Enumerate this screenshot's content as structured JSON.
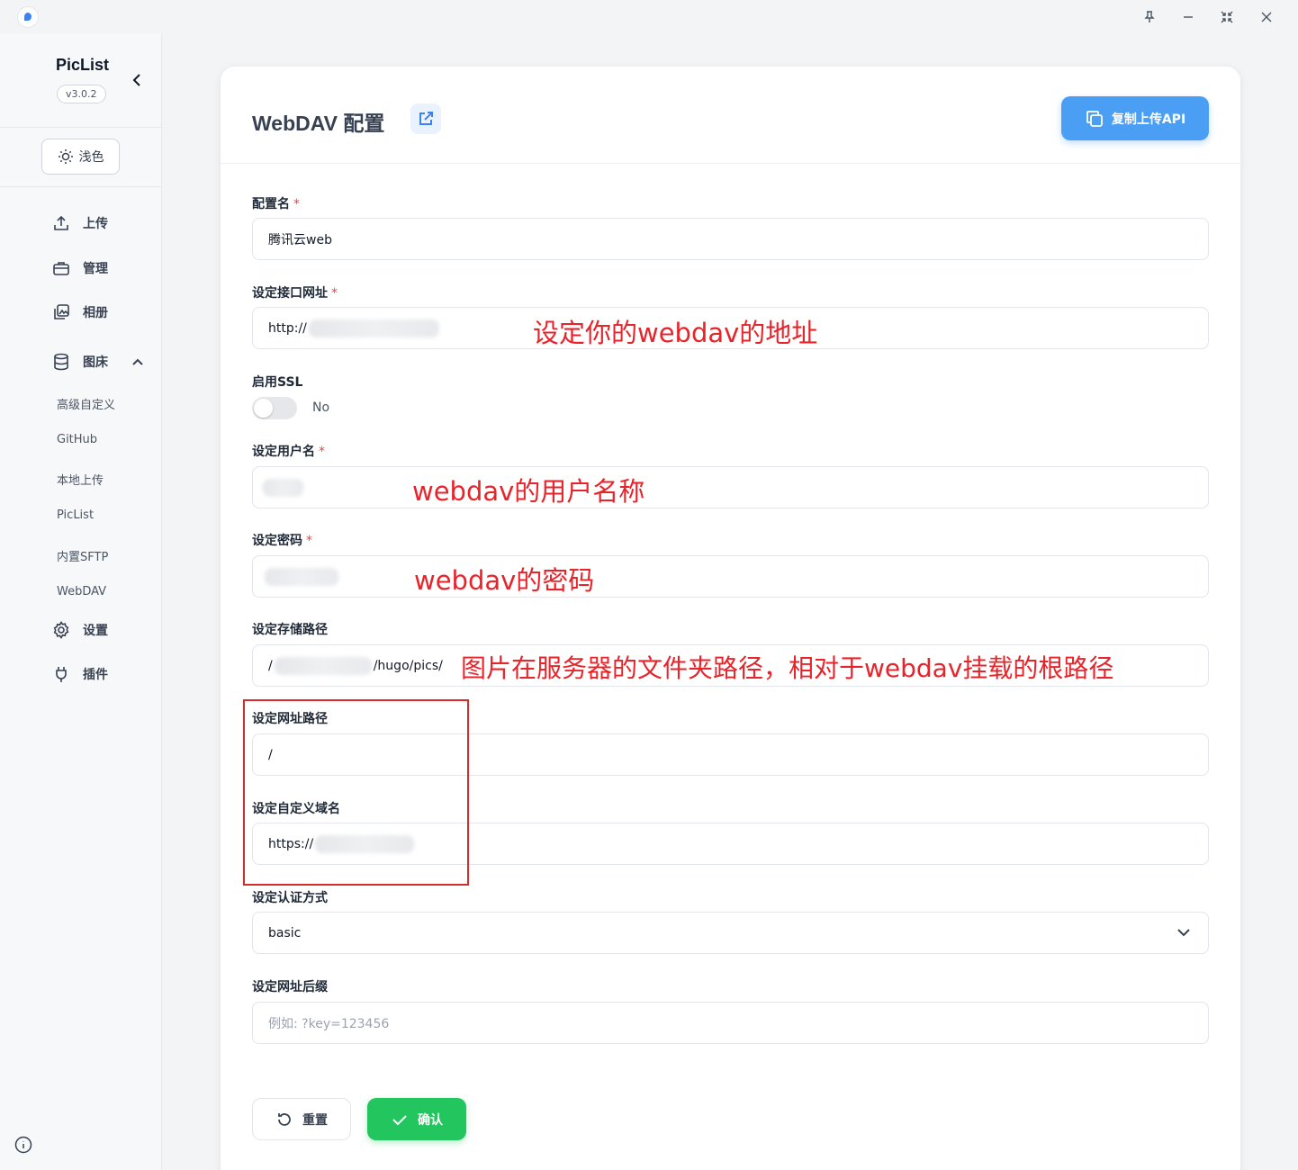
{
  "titlebar": {
    "controls": [
      "pin-icon",
      "minimize-icon",
      "collapse-window-icon",
      "close-icon"
    ]
  },
  "sidebar": {
    "brand_name": "PicList",
    "version": "v3.0.2",
    "theme_label": "浅色",
    "nav": {
      "upload": "上传",
      "manage": "管理",
      "gallery": "相册",
      "picbed": "图床",
      "settings": "设置",
      "plugins": "插件"
    },
    "picbed_items": [
      "高级自定义",
      "GitHub",
      "本地上传",
      "PicList",
      "内置SFTP",
      "WebDAV"
    ]
  },
  "header": {
    "title": "WebDAV 配置",
    "copy_api_label": "复制上传API"
  },
  "form": {
    "config_name": {
      "label": "配置名",
      "value": "腾讯云web"
    },
    "host": {
      "label": "设定接口网址",
      "value": "http://"
    },
    "ssl": {
      "label": "启用SSL",
      "state": "No"
    },
    "username": {
      "label": "设定用户名"
    },
    "password": {
      "label": "设定密码"
    },
    "path": {
      "label": "设定存储路径",
      "value_prefix": "/",
      "value_suffix": "/hugo/pics/"
    },
    "web_path": {
      "label": "设定网址路径",
      "value": "/"
    },
    "custom_url": {
      "label": "设定自定义域名",
      "value": "https://"
    },
    "auth_type": {
      "label": "设定认证方式",
      "value": "basic"
    },
    "url_suffix": {
      "label": "设定网址后缀",
      "placeholder": "例如: ?key=123456"
    }
  },
  "annotations": {
    "host_note": "设定你的webdav的地址",
    "username_note": "webdav的用户名称",
    "password_note": "webdav的密码",
    "path_note": "图片在服务器的文件夹路径，相对于webdav挂载的根路径"
  },
  "actions": {
    "reset": "重置",
    "confirm": "确认"
  },
  "colors": {
    "accent_blue": "#4a9ff5",
    "confirm_green": "#22c55e",
    "annotation_red": "#e8232a"
  }
}
